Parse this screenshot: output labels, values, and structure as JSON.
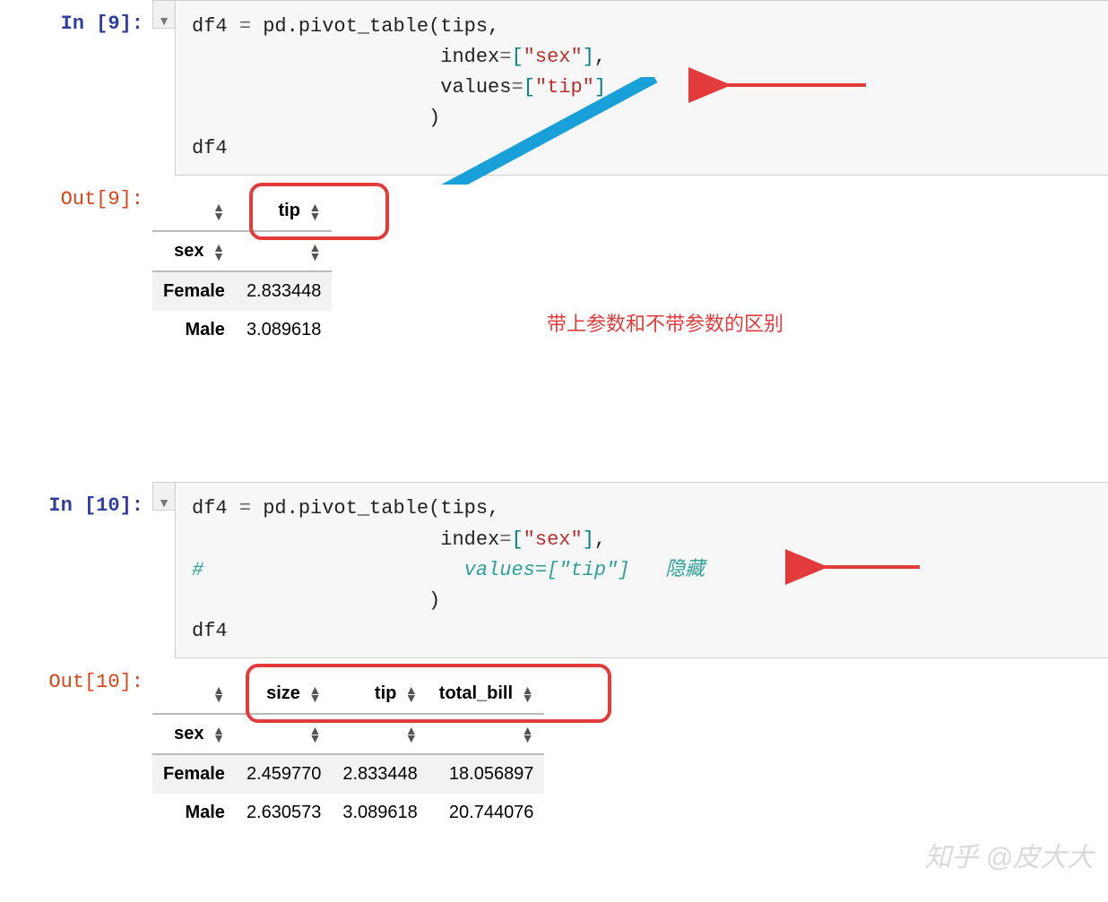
{
  "cell1": {
    "prompt_in": "In [9]:",
    "prompt_out": "Out[9]:",
    "code_lines": {
      "l1a": "df4 ",
      "l1b": "= ",
      "l1c": "pd.pivot_table(tips,",
      "l2a": "                     index",
      "l2b": "=",
      "l2c": "[",
      "l2d": "\"sex\"",
      "l2e": "]",
      "l2f": ",",
      "l3a": "                     values",
      "l3b": "=",
      "l3c": "[",
      "l3d": "\"tip\"",
      "l3e": "]",
      "l4": "                    )",
      "l5": "df4"
    },
    "table": {
      "columns": [
        "tip"
      ],
      "index_name": "sex",
      "rows": [
        {
          "idx": "Female",
          "vals": [
            "2.833448"
          ]
        },
        {
          "idx": "Male",
          "vals": [
            "3.089618"
          ]
        }
      ]
    },
    "annotation": "带上参数和不带参数的区别"
  },
  "cell2": {
    "prompt_in": "In [10]:",
    "prompt_out": "Out[10]:",
    "code_lines": {
      "l1a": "df4 ",
      "l1b": "= ",
      "l1c": "pd.pivot_table(tips,",
      "l2a": "                     index",
      "l2b": "=",
      "l2c": "[",
      "l2d": "\"sex\"",
      "l2e": "]",
      "l2f": ",",
      "l3": "#                      values=[\"tip\"]   隐藏",
      "l4": "                    )",
      "l5": "df4"
    },
    "table": {
      "columns": [
        "size",
        "tip",
        "total_bill"
      ],
      "index_name": "sex",
      "rows": [
        {
          "idx": "Female",
          "vals": [
            "2.459770",
            "2.833448",
            "18.056897"
          ]
        },
        {
          "idx": "Male",
          "vals": [
            "2.630573",
            "3.089618",
            "20.744076"
          ]
        }
      ]
    }
  },
  "watermark": "知乎 @皮大大"
}
